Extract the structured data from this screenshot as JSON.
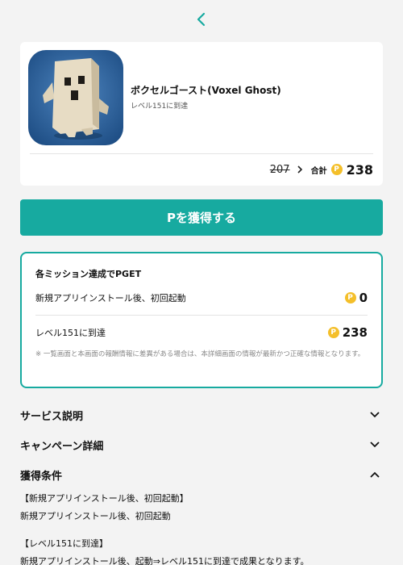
{
  "nav": {
    "back_icon": "chevron-left-icon"
  },
  "app": {
    "title": "ボクセルゴースト(Voxel Ghost)",
    "subtitle": "レベル151に到達",
    "icon": "voxel-ghost-app-icon",
    "old_points": "207",
    "total_label": "合計",
    "total_points": "238",
    "coin_symbol": "P"
  },
  "cta": {
    "label": "Pを獲得する"
  },
  "missions": {
    "heading": "各ミッション達成でPGET",
    "items": [
      {
        "label": "新規アプリインストール後、初回起動",
        "points": "0"
      },
      {
        "label": "レベル151に到達",
        "points": "238"
      }
    ],
    "note": "※ 一覧画面と本画面の報酬情報に差異がある場合は、本詳細画面の情報が最新かつ正確な情報となります。"
  },
  "sections": [
    {
      "title": "サービス説明",
      "state": "collapsed"
    },
    {
      "title": "キャンペーン詳細",
      "state": "collapsed"
    },
    {
      "title": "獲得条件",
      "state": "expanded"
    }
  ],
  "conditions": [
    "【新規アプリインストール後、初回起動】",
    "新規アプリインストール後、初回起動",
    "【レベル151に到達】",
    "新規アプリインストール後、起動⇒レベル151に到達で成果となります。"
  ],
  "colors": {
    "accent": "#17aaa0",
    "coin": "#f4bf2a",
    "background": "#f3f3f3"
  }
}
